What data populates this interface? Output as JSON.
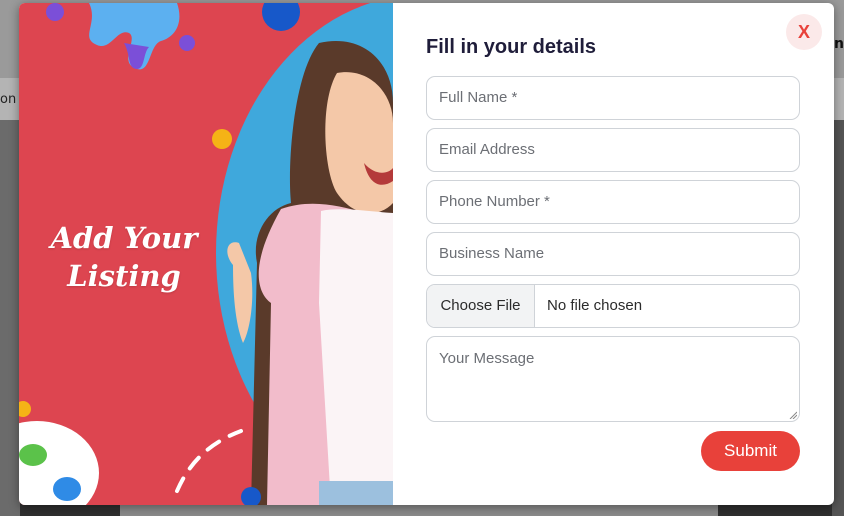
{
  "background": {
    "nav_fragment": "on",
    "header_fragment": "n"
  },
  "modal": {
    "banner_title": "Add Your Listing",
    "close_label": "X",
    "form_title": "Fill in your details",
    "fields": {
      "full_name_placeholder": "Full Name *",
      "email_placeholder": "Email Address",
      "phone_placeholder": "Phone Number *",
      "business_placeholder": "Business Name",
      "message_placeholder": "Your Message"
    },
    "file_input": {
      "button_label": "Choose File",
      "status": "No file chosen"
    },
    "submit_label": "Submit"
  },
  "colors": {
    "banner_red": "#DD4550",
    "circle_blue": "#3FA8DC",
    "accent": "#E8413A",
    "title_navy": "#1F1D3A"
  }
}
